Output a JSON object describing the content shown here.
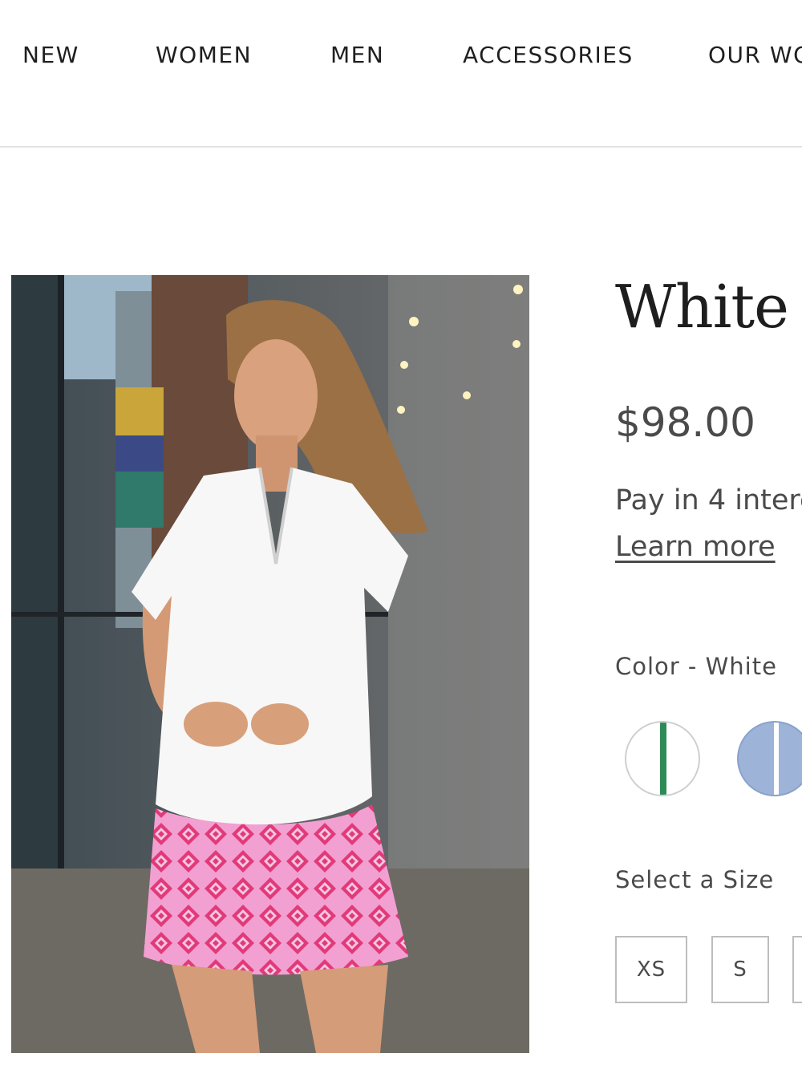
{
  "nav": {
    "items": [
      {
        "label": "NEW"
      },
      {
        "label": "WOMEN"
      },
      {
        "label": "MEN"
      },
      {
        "label": "ACCESSORIES"
      },
      {
        "label": "OUR WO"
      }
    ]
  },
  "product": {
    "title": "White",
    "price": "$98.00",
    "pay_text": "Pay in 4 intere",
    "learn_more": "Learn more",
    "color_label": "Color - White",
    "colors": [
      {
        "name": "White",
        "base": "#ffffff",
        "stripe": "#2e8b57"
      },
      {
        "name": "Blue",
        "base": "#9db3d8",
        "stripe": "#ffffff"
      }
    ],
    "size_label": "Select a Size",
    "sizes": [
      "XS",
      "S",
      ""
    ]
  }
}
